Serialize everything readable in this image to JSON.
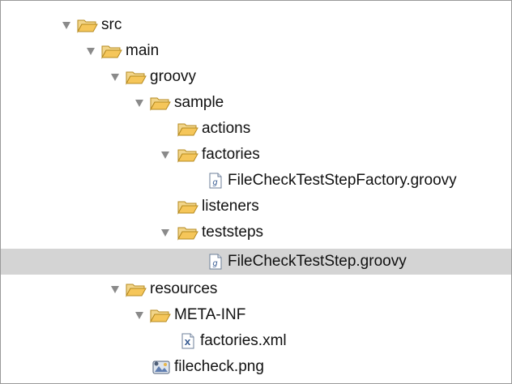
{
  "tree": {
    "rows": [
      {
        "label": "src",
        "icon": "folder-open-icon",
        "expanded": true
      },
      {
        "label": "main",
        "icon": "folder-open-icon",
        "expanded": true
      },
      {
        "label": "groovy",
        "icon": "folder-open-icon",
        "expanded": true
      },
      {
        "label": "sample",
        "icon": "folder-open-icon",
        "expanded": true
      },
      {
        "label": "actions",
        "icon": "folder-icon",
        "expanded": false
      },
      {
        "label": "factories",
        "icon": "folder-open-icon",
        "expanded": true
      },
      {
        "label": "FileCheckTestStepFactory.groovy",
        "icon": "groovy-file-icon"
      },
      {
        "label": "listeners",
        "icon": "folder-icon",
        "expanded": false
      },
      {
        "label": "teststeps",
        "icon": "folder-open-icon",
        "expanded": true
      },
      {
        "label": "FileCheckTestStep.groovy",
        "icon": "groovy-file-icon",
        "selected": true
      },
      {
        "label": "resources",
        "icon": "folder-open-icon",
        "expanded": true
      },
      {
        "label": "META-INF",
        "icon": "folder-open-icon",
        "expanded": true
      },
      {
        "label": "factories.xml",
        "icon": "xml-file-icon"
      },
      {
        "label": "filecheck.png",
        "icon": "image-file-icon"
      }
    ]
  },
  "colors": {
    "selection": "#d4d4d4",
    "folder": "#f5c65a",
    "folder_outline": "#b58a1f",
    "twisty": "#8a8a8a"
  }
}
